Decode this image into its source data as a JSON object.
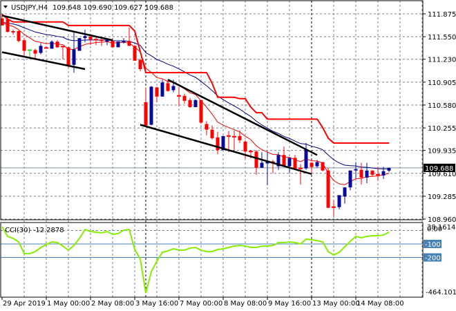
{
  "header": {
    "symbol": "USDJPY,H4",
    "ohlc": "109.648 109.690 109.627 109.688"
  },
  "colors": {
    "bull": "#0a0a9a",
    "bear": "#ff0000",
    "highlight": "#22dd22",
    "ema_fast": "#ff0000",
    "ema_slow": "#000080",
    "step_line": "#ff0000",
    "trendline": "#000000",
    "cci": "#88ee00",
    "cci_level": "#4682b4",
    "grid": "#708090"
  },
  "chart_data": [
    {
      "type": "candlestick",
      "title": "USDJPY,H4",
      "current_price": "109.688",
      "ylim": [
        108.96,
        111.875
      ],
      "y_ticks": [
        "111.875",
        "111.550",
        "111.230",
        "110.905",
        "110.580",
        "110.255",
        "109.935",
        "109.610",
        "109.285",
        "108.960"
      ],
      "x_ticks": [
        {
          "bar": 0,
          "label": "29 Apr 2019"
        },
        {
          "bar": 8,
          "label": "1 May 00:00"
        },
        {
          "bar": 16,
          "label": "2 May 08:00"
        },
        {
          "bar": 24,
          "label": "3 May 16:00"
        },
        {
          "bar": 32,
          "label": "7 May 00:00"
        },
        {
          "bar": 40,
          "label": "8 May 08:00"
        },
        {
          "bar": 48,
          "label": "9 May 16:00"
        },
        {
          "bar": 56,
          "label": "13 May 00:00"
        },
        {
          "bar": 64,
          "label": "14 May 08:00"
        }
      ],
      "separator_bars": [
        26,
        56
      ],
      "highlight_bar": 5,
      "ohlc": [
        [
          111.81,
          111.87,
          111.71,
          111.71
        ],
        [
          111.8,
          111.83,
          111.61,
          111.62
        ],
        [
          111.63,
          111.65,
          111.58,
          111.61
        ],
        [
          111.63,
          111.64,
          111.47,
          111.49
        ],
        [
          111.5,
          111.53,
          111.27,
          111.35
        ],
        [
          111.36,
          111.37,
          111.23,
          111.36
        ],
        [
          111.36,
          111.38,
          111.23,
          111.31
        ],
        [
          111.32,
          111.46,
          111.3,
          111.42
        ],
        [
          111.39,
          111.42,
          111.38,
          111.39
        ],
        [
          111.38,
          111.5,
          111.38,
          111.48
        ],
        [
          111.48,
          111.5,
          111.39,
          111.4
        ],
        [
          111.41,
          111.41,
          111.23,
          111.41
        ],
        [
          111.4,
          111.41,
          111.11,
          111.14
        ],
        [
          111.15,
          111.61,
          111.04,
          111.37
        ],
        [
          111.35,
          111.53,
          111.35,
          111.53
        ],
        [
          111.53,
          111.65,
          111.47,
          111.56
        ],
        [
          111.55,
          111.58,
          111.43,
          111.51
        ],
        [
          111.51,
          111.56,
          111.43,
          111.51
        ],
        [
          111.51,
          111.54,
          111.42,
          111.49
        ],
        [
          111.48,
          111.53,
          111.43,
          111.5
        ],
        [
          111.49,
          111.53,
          111.4,
          111.4
        ],
        [
          111.4,
          111.48,
          111.4,
          111.48
        ],
        [
          111.47,
          111.53,
          111.45,
          111.49
        ],
        [
          111.49,
          111.68,
          111.42,
          111.42
        ],
        [
          111.42,
          111.43,
          111.21,
          111.21
        ],
        [
          111.22,
          111.24,
          111.06,
          111.09
        ],
        [
          110.62,
          110.83,
          110.27,
          110.29
        ],
        [
          110.3,
          110.85,
          110.29,
          110.84
        ],
        [
          110.83,
          110.84,
          110.62,
          110.7
        ],
        [
          110.7,
          110.94,
          110.7,
          110.9
        ],
        [
          110.89,
          110.94,
          110.77,
          110.78
        ],
        [
          110.79,
          110.94,
          110.76,
          110.85
        ],
        [
          110.71,
          110.84,
          110.56,
          110.71
        ],
        [
          110.71,
          110.74,
          110.6,
          110.64
        ],
        [
          110.65,
          110.68,
          110.54,
          110.55
        ],
        [
          110.55,
          110.66,
          110.55,
          110.65
        ],
        [
          110.65,
          110.65,
          110.31,
          110.33
        ],
        [
          110.31,
          110.35,
          110.15,
          110.23
        ],
        [
          110.23,
          110.29,
          110.09,
          110.11
        ],
        [
          110.12,
          110.2,
          109.88,
          109.94
        ],
        [
          109.94,
          110.14,
          109.94,
          110.14
        ],
        [
          110.14,
          110.21,
          109.91,
          110.14
        ],
        [
          110.13,
          110.22,
          109.94,
          110.13
        ],
        [
          110.14,
          110.22,
          110.04,
          110.08
        ],
        [
          110.06,
          110.08,
          109.82,
          109.92
        ],
        [
          109.92,
          109.94,
          109.82,
          109.92
        ],
        [
          109.92,
          109.94,
          109.59,
          109.69
        ],
        [
          109.69,
          109.91,
          109.69,
          109.76
        ],
        [
          109.75,
          109.91,
          109.44,
          109.79
        ],
        [
          109.78,
          109.8,
          109.61,
          109.76
        ],
        [
          109.71,
          109.91,
          109.66,
          109.87
        ],
        [
          109.87,
          109.99,
          109.7,
          109.71
        ],
        [
          109.71,
          109.83,
          109.61,
          109.83
        ],
        [
          109.83,
          109.87,
          109.66,
          109.68
        ],
        [
          109.68,
          109.74,
          109.45,
          109.68
        ],
        [
          109.68,
          110.04,
          109.66,
          109.95
        ],
        [
          109.76,
          109.77,
          109.6,
          109.7
        ],
        [
          109.71,
          109.8,
          109.69,
          109.77
        ],
        [
          109.77,
          109.77,
          109.64,
          109.65
        ],
        [
          109.65,
          109.69,
          109.12,
          109.12
        ],
        [
          109.13,
          109.23,
          109.0,
          109.13
        ],
        [
          109.13,
          109.3,
          109.1,
          109.3
        ],
        [
          109.28,
          109.41,
          109.18,
          109.41
        ],
        [
          109.41,
          109.65,
          109.37,
          109.65
        ],
        [
          109.65,
          109.77,
          109.54,
          109.67
        ],
        [
          109.66,
          109.76,
          109.45,
          109.55
        ],
        [
          109.55,
          109.76,
          109.47,
          109.65
        ],
        [
          109.65,
          109.65,
          109.56,
          109.59
        ],
        [
          109.59,
          109.69,
          109.51,
          109.59
        ],
        [
          109.58,
          109.7,
          109.53,
          109.64
        ],
        [
          109.648,
          109.69,
          109.627,
          109.688
        ]
      ],
      "step_line": [
        111.87,
        111.8,
        111.76,
        111.76,
        111.76,
        111.76,
        111.76,
        111.76,
        111.76,
        111.76,
        111.76,
        111.76,
        111.71,
        111.71,
        111.71,
        111.71,
        111.71,
        111.71,
        111.71,
        111.71,
        111.71,
        111.71,
        111.71,
        111.71,
        111.63,
        111.34,
        111.04,
        111.04,
        111.04,
        111.04,
        111.04,
        111.04,
        111.04,
        111.04,
        111.04,
        111.04,
        111.04,
        111.04,
        110.89,
        110.69,
        110.69,
        110.69,
        110.69,
        110.67,
        110.67,
        110.55,
        110.47,
        110.47,
        110.38,
        110.38,
        110.38,
        110.38,
        110.38,
        110.38,
        110.38,
        110.38,
        110.38,
        110.38,
        110.26,
        110.11,
        110.04,
        110.04,
        110.04,
        110.04,
        110.04,
        110.04,
        110.04,
        110.04,
        110.04,
        110.04,
        110.04
      ],
      "trendlines": [
        {
          "from_bar": 0,
          "from_price": 111.85,
          "to_bar": 20,
          "to_price": 111.5
        },
        {
          "from_bar": 0,
          "from_price": 111.33,
          "to_bar": 15,
          "to_price": 111.09
        },
        {
          "from_bar": 30,
          "from_price": 110.94,
          "to_bar": 57,
          "to_price": 109.87
        },
        {
          "from_bar": 25,
          "from_price": 110.3,
          "to_bar": 56,
          "to_price": 109.6
        }
      ]
    },
    {
      "type": "line",
      "title": "CCI(30) -12.2878",
      "ylim": [
        -464.1012,
        38.1614
      ],
      "y_labels": {
        "max": "38.1614",
        "zero": "0.00",
        "level1": "-100",
        "level2": "-200",
        "min": "-464.1012"
      },
      "levels": [
        -100,
        -200
      ],
      "values": [
        28,
        -44,
        -59,
        -85,
        -172,
        -172,
        -157,
        -126,
        -105,
        -85,
        -90,
        -116,
        -146,
        -111,
        -59,
        7,
        -8,
        -13,
        -18,
        -8,
        -29,
        -23,
        2,
        7,
        -141,
        -213,
        -464,
        -305,
        -228,
        -162,
        -152,
        -136,
        -146,
        -146,
        -131,
        -126,
        -146,
        -157,
        -157,
        -141,
        -136,
        -126,
        -116,
        -111,
        -116,
        -126,
        -126,
        -116,
        -116,
        -111,
        -90,
        -90,
        -85,
        -90,
        -100,
        -64,
        -69,
        -75,
        -85,
        -157,
        -182,
        -162,
        -121,
        -80,
        -44,
        -54,
        -44,
        -39,
        -39,
        -34,
        -12.2878
      ]
    }
  ]
}
